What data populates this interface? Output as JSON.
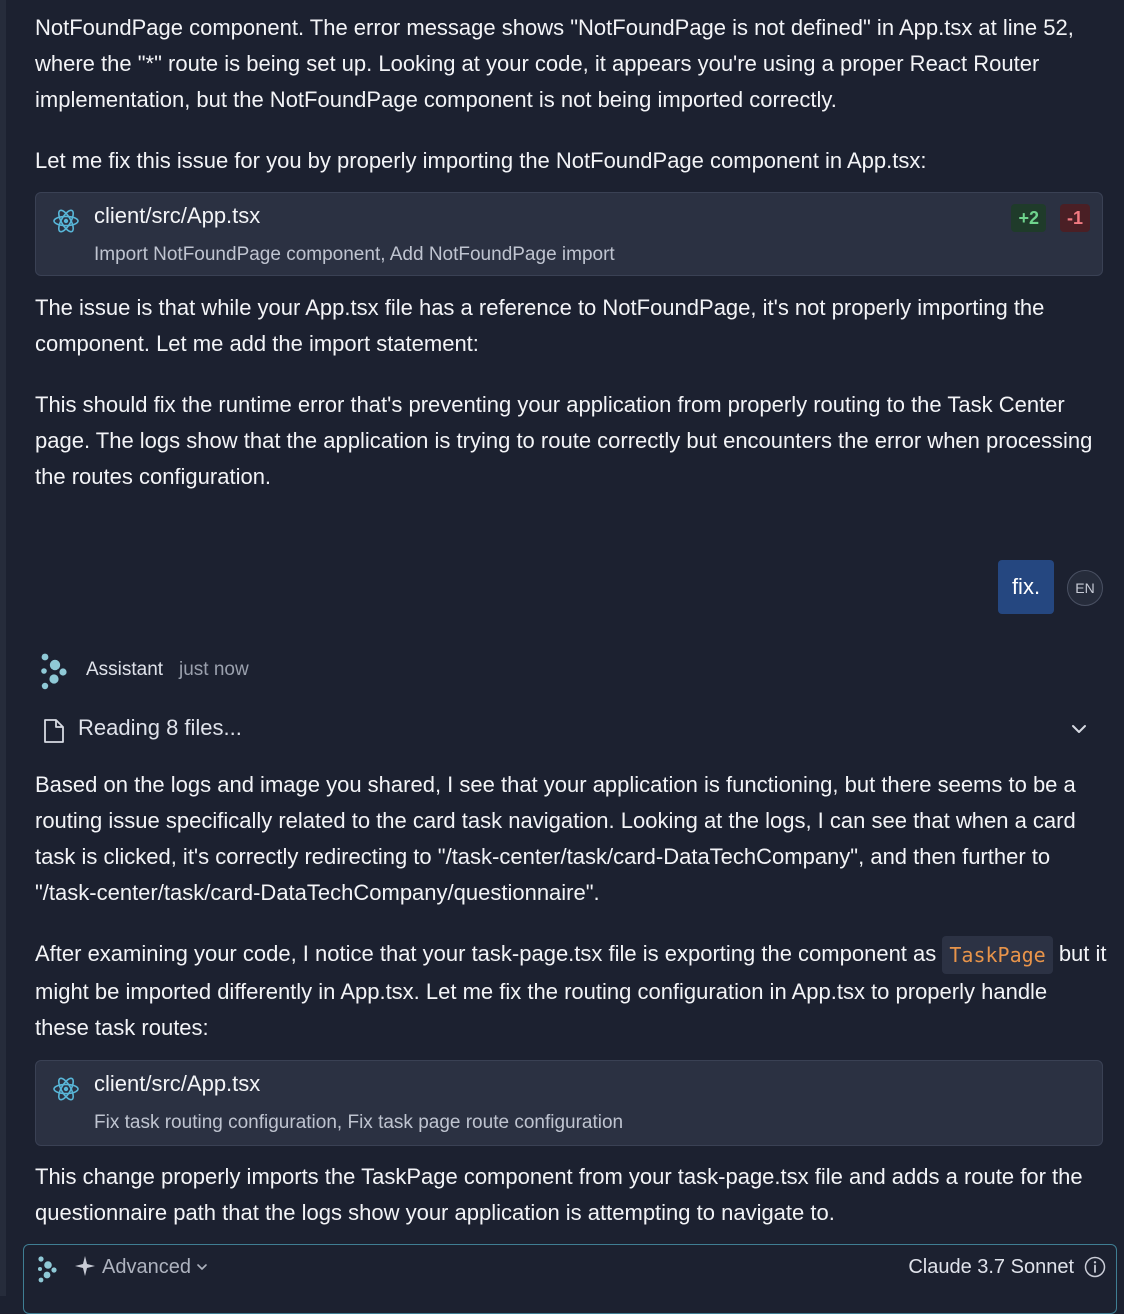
{
  "messages": {
    "p1": "NotFoundPage component. The error message shows \"NotFoundPage is not defined\" in App.tsx at line 52, where the \"*\" route is being set up. Looking at your code, it appears you're using a proper React Router implementation, but the NotFoundPage component is not being imported correctly.",
    "p2": "Let me fix this issue for you by properly importing the NotFoundPage component in App.tsx:",
    "p3": "The issue is that while your App.tsx file has a reference to NotFoundPage, it's not properly importing the component. Let me add the import statement:",
    "p4": "This should fix the runtime error that's preventing your application from properly routing to the Task Center page. The logs show that the application is trying to route correctly but encounters the error when processing the routes configuration.",
    "p5": "Based on the logs and image you shared, I see that your application is functioning, but there seems to be a routing issue specifically related to the card task navigation. Looking at the logs, I can see that when a card task is clicked, it's correctly redirecting to \"/task-center/task/card-DataTechCompany\", and then further to \"/task-center/task/card-DataTechCompany/questionnaire\".",
    "p6_before": "After examining your code, I notice that your task-page.tsx file is exporting the component as ",
    "p6_code": "TaskPage",
    "p6_after": " but it might be imported differently in App.tsx. Let me fix the routing configuration in App.tsx to properly handle these task routes:",
    "p7": "This change properly imports the TaskPage component from your task-page.tsx file and adds a route for the questionnaire path that the logs show your application is attempting to navigate to."
  },
  "file_cards": [
    {
      "filename": "client/src/App.tsx",
      "description": "Import NotFoundPage component, Add NotFoundPage import",
      "added": "+2",
      "removed": "-1"
    },
    {
      "filename": "client/src/App.tsx",
      "description": "Fix task routing configuration, Fix task page route configuration"
    }
  ],
  "user_message": {
    "text": "fix.",
    "lang": "EN"
  },
  "assistant": {
    "name": "Assistant",
    "time": "just now"
  },
  "reading": {
    "label": "Reading 8 files..."
  },
  "input_bar": {
    "mode": "Advanced",
    "model": "Claude 3.7 Sonnet"
  },
  "colors": {
    "background": "#1c2130",
    "card": "#2b3142",
    "user_bubble": "#254780",
    "accent": "#3f7e93",
    "code": "#e8944a",
    "added": "#6fd48d",
    "removed": "#f27a82"
  }
}
